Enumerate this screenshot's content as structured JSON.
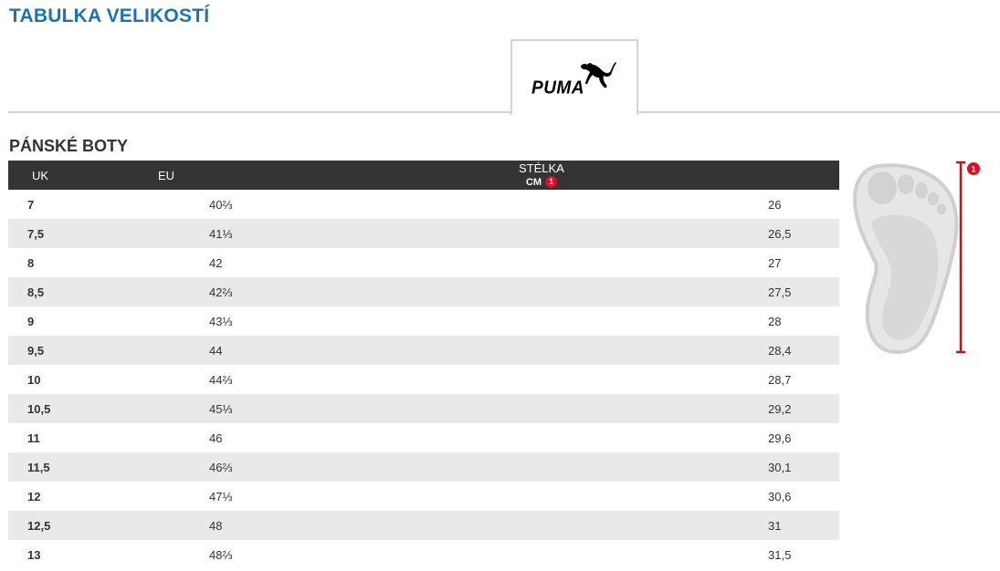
{
  "page": {
    "title": "TABULKA VELIKOSTÍ"
  },
  "brand": {
    "tab_name": "PUMA",
    "logo_icon": "puma-cat-icon"
  },
  "section": {
    "title": "PÁNSKÉ BOTY"
  },
  "table": {
    "headers": {
      "uk": "UK",
      "eu": "EU",
      "insole": "STÉLKA",
      "insole_unit": "CM",
      "insole_marker": "1"
    },
    "rows": [
      {
        "uk": "7",
        "eu": "40⅔",
        "cm": "26"
      },
      {
        "uk": "7,5",
        "eu": "41⅓",
        "cm": "26,5"
      },
      {
        "uk": "8",
        "eu": "42",
        "cm": "27"
      },
      {
        "uk": "8,5",
        "eu": "42⅔",
        "cm": "27,5"
      },
      {
        "uk": "9",
        "eu": "43⅓",
        "cm": "28"
      },
      {
        "uk": "9,5",
        "eu": "44",
        "cm": "28,4"
      },
      {
        "uk": "10",
        "eu": "44⅔",
        "cm": "28,7"
      },
      {
        "uk": "10,5",
        "eu": "45⅓",
        "cm": "29,2"
      },
      {
        "uk": "11",
        "eu": "46",
        "cm": "29,6"
      },
      {
        "uk": "11,5",
        "eu": "46⅔",
        "cm": "30,1"
      },
      {
        "uk": "12",
        "eu": "47⅓",
        "cm": "30,6"
      },
      {
        "uk": "12,5",
        "eu": "48",
        "cm": "31"
      },
      {
        "uk": "13",
        "eu": "48⅔",
        "cm": "31,5"
      }
    ]
  },
  "foot_diagram": {
    "icon": "foot-length-icon",
    "marker": "1",
    "marker_color": "#e30b24"
  },
  "colors": {
    "title_blue": "#1a73b8",
    "header_dark": "#343434",
    "row_stripe": "#e9e9e9",
    "accent_red": "#e30b24"
  }
}
